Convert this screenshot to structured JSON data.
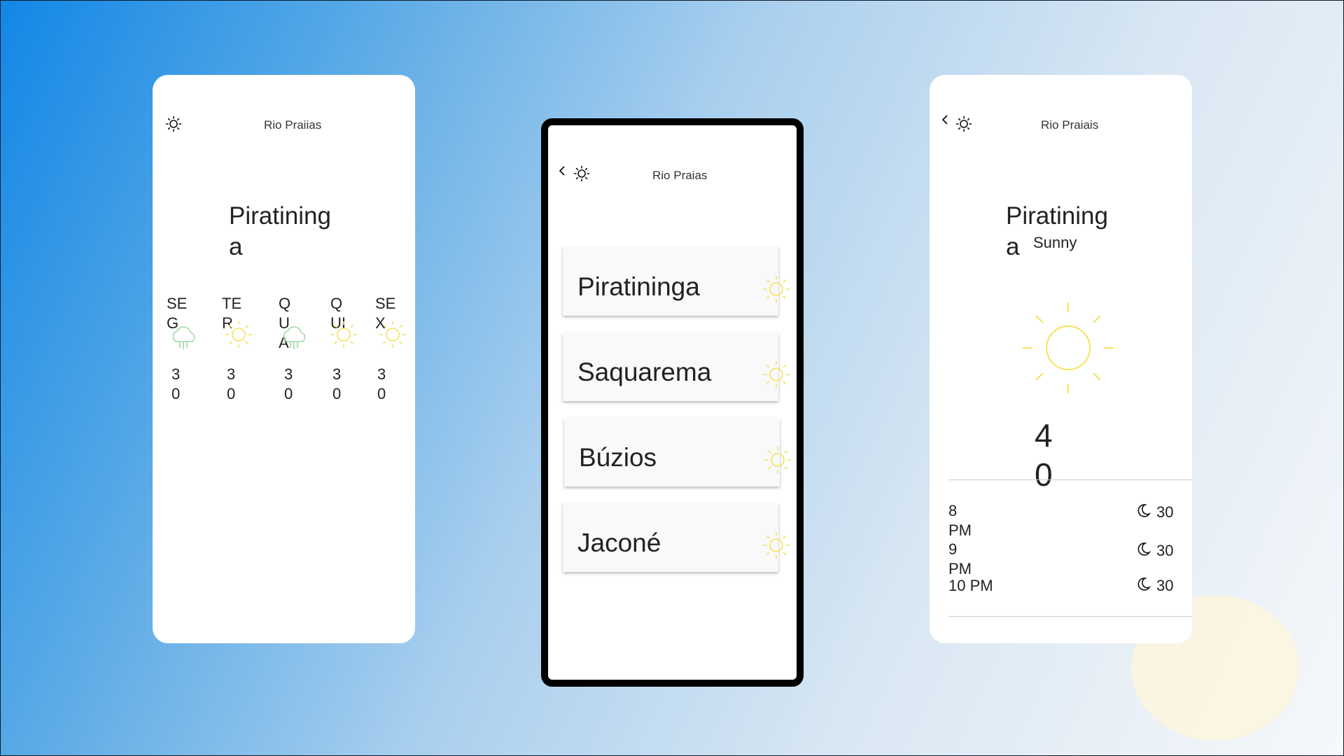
{
  "screen1": {
    "title": "Rio Praiias",
    "city": "Piratininga",
    "forecast": [
      {
        "day": "SEG",
        "icon": "rain-cloud-icon",
        "temp": "30"
      },
      {
        "day": "TER",
        "icon": "sun-icon",
        "temp": "30"
      },
      {
        "day": "QUA",
        "icon": "rain-cloud-icon",
        "temp": "30"
      },
      {
        "day": "QUI",
        "icon": "sun-icon",
        "temp": "30"
      },
      {
        "day": "SEX",
        "icon": "sun-icon",
        "temp": "30"
      }
    ]
  },
  "screen2": {
    "title": "Rio Praias",
    "beaches": [
      {
        "name": "Piratininga",
        "icon": "sun-icon"
      },
      {
        "name": "Saquarema",
        "icon": "sun-icon"
      },
      {
        "name": "Búzios",
        "icon": "sun-icon"
      },
      {
        "name": "Jaconé",
        "icon": "sun-icon"
      }
    ]
  },
  "screen3": {
    "title": "Rio Praiais",
    "city": "Piratininga",
    "condition": "Sunny",
    "temperature": "40",
    "hourly": [
      {
        "time": "8 PM",
        "icon": "moon-icon",
        "temp": "30"
      },
      {
        "time": "9 PM",
        "icon": "moon-icon",
        "temp": "30"
      },
      {
        "time": "10 PM",
        "icon": "moon-icon",
        "temp": "30"
      }
    ]
  },
  "colors": {
    "sun": "#f5e25a",
    "rain": "#9fd9a5",
    "gradient_start": "#1287e6",
    "gradient_end": "#f6f8fa"
  }
}
